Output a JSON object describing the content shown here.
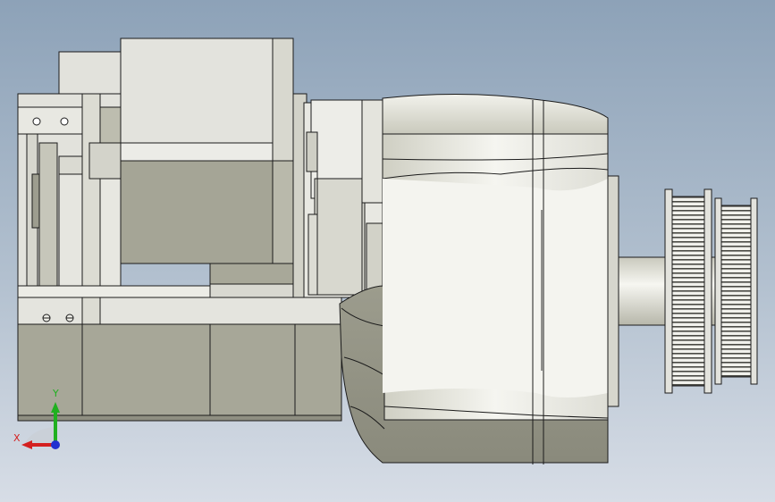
{
  "viewport": {
    "background_top": "#8da2b8",
    "background_bottom": "#d7dde6",
    "model": "motor-pulley-assembly"
  },
  "colors": {
    "light_face": "#e3e3dd",
    "shaded_face": "#a9a99a",
    "dark_face": "#8f8f82",
    "edge": "#1b1b1b",
    "highlight": "#f7f7f2"
  },
  "triad": {
    "x_label": "X",
    "y_label": "Y",
    "x_color": "#d42020",
    "y_color": "#20b020",
    "z_color": "#2030d0"
  }
}
